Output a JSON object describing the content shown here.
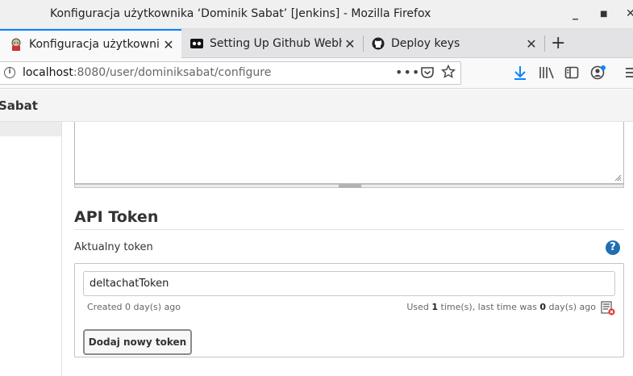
{
  "window": {
    "title": "Konfiguracja użytkownika ‘Dominik Sabat’ [Jenkins] - Mozilla Firefox"
  },
  "tabs": [
    {
      "label": "Konfiguracja użytkownika ‘Dominik Sabat’",
      "icon": "jenkins-icon",
      "active": true
    },
    {
      "label": "Setting Up Github Webhooks",
      "icon": "video-icon",
      "active": false
    },
    {
      "label": "Deploy keys",
      "icon": "github-icon",
      "active": false
    }
  ],
  "urlbar": {
    "host": "localhost",
    "path": ":8080/user/dominiksabat/configure"
  },
  "page": {
    "user_name": "Sabat",
    "section_title": "API Token",
    "current_token_label": "Aktualny token",
    "help_glyph": "?",
    "token": {
      "name": "deltachatToken",
      "created": "Created 0 day(s) ago",
      "used_prefix": "Used ",
      "used_count": "1",
      "used_mid": " time(s), last time was ",
      "used_days": "0",
      "used_suffix": " day(s) ago"
    },
    "add_token_label": "Dodaj nowy token"
  },
  "colors": {
    "accent": "#0a84ff",
    "help": "#1f6fb2",
    "download": "#0a84ff"
  }
}
